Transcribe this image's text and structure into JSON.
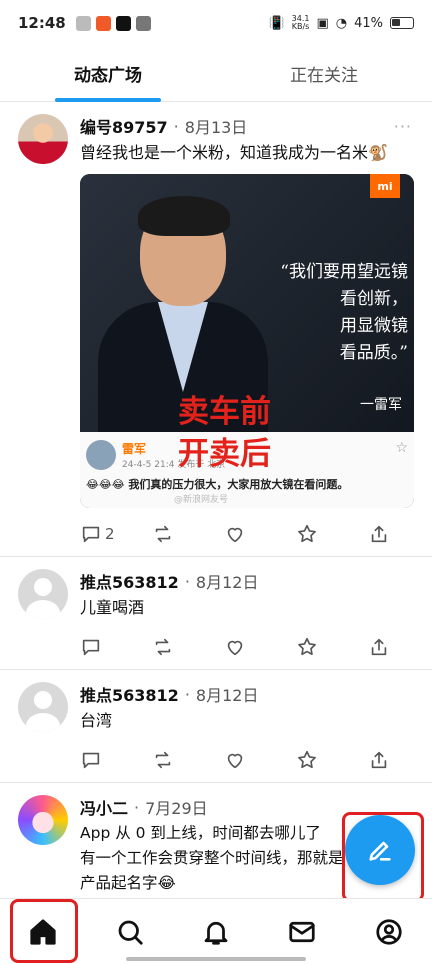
{
  "status_bar": {
    "time": "12:48",
    "net_speed_top": "34.1",
    "net_speed_bottom": "KB/s",
    "battery": "41%"
  },
  "tabs": [
    {
      "label": "动态广场",
      "active": true
    },
    {
      "label": "正在关注",
      "active": false
    }
  ],
  "posts": [
    {
      "username": "编号89757",
      "date": "8月13日",
      "text": "曾经我也是一个米粉，知道我成为一名米🐒",
      "comment_count": "2",
      "image": {
        "logo": "mi",
        "quote": "“我们要用望远镜\n看创新，\n用显微镜\n看品质。”",
        "author": "一雷军",
        "overlay_top": "卖车前",
        "overlay_bottom": "开卖后",
        "embedded_name": "雷军",
        "embedded_meta": "24-4-5 21:4  发布于 北京",
        "embedded_text": "😂😂😂 我们真的压力很大，大家用放大镜在看问题。",
        "watermark": "@新浪网友号"
      }
    },
    {
      "username": "推点563812",
      "date": "8月12日",
      "text": "儿童喝酒",
      "comment_count": ""
    },
    {
      "username": "推点563812",
      "date": "8月12日",
      "text": "台湾",
      "comment_count": ""
    },
    {
      "username": "冯小二",
      "date": "7月29日",
      "text": "App 从 0 到上线，时间都去哪儿了\n有一个工作会贯穿整个时间线，那就是\n产品起名字😂",
      "comment_count": ""
    }
  ],
  "separator": "·",
  "more_label": "···",
  "colors": {
    "accent": "#1d9bf0",
    "highlight_box": "#e02020"
  },
  "bottom_nav": [
    "home-icon",
    "search-icon",
    "bell-icon",
    "mail-icon",
    "profile-icon"
  ]
}
